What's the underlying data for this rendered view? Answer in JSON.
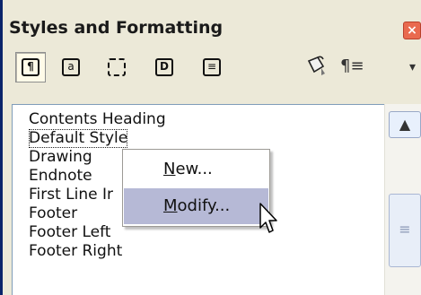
{
  "panel": {
    "title": "Styles and Formatting",
    "close_label": "×"
  },
  "toolbar": {
    "buttons": [
      {
        "name": "paragraph-styles",
        "glyph": "¶",
        "active": true
      },
      {
        "name": "character-styles",
        "glyph": "a",
        "active": false
      },
      {
        "name": "frame-styles",
        "glyph": "",
        "active": false
      },
      {
        "name": "page-styles",
        "glyph": "D",
        "active": false
      },
      {
        "name": "list-styles",
        "glyph": "≡",
        "active": false
      }
    ],
    "fill_format_icon": "paint-bucket-icon",
    "new_style_icon": "¶≡",
    "dropdown_icon": "▾"
  },
  "styles_list": {
    "items": [
      "Contents Heading",
      "Default Style",
      "Drawing",
      "Endnote",
      "First Line Ir",
      "Footer",
      "Footer Left",
      "Footer Right"
    ],
    "selected": "Default Style"
  },
  "context_menu": {
    "items": [
      {
        "label": "New...",
        "accel": "N"
      },
      {
        "label": "Modify...",
        "accel": "M"
      }
    ],
    "hovered": "Modify..."
  },
  "colors": {
    "hover_bg": "#b6b9d6",
    "close_button": "#e96a4f"
  }
}
